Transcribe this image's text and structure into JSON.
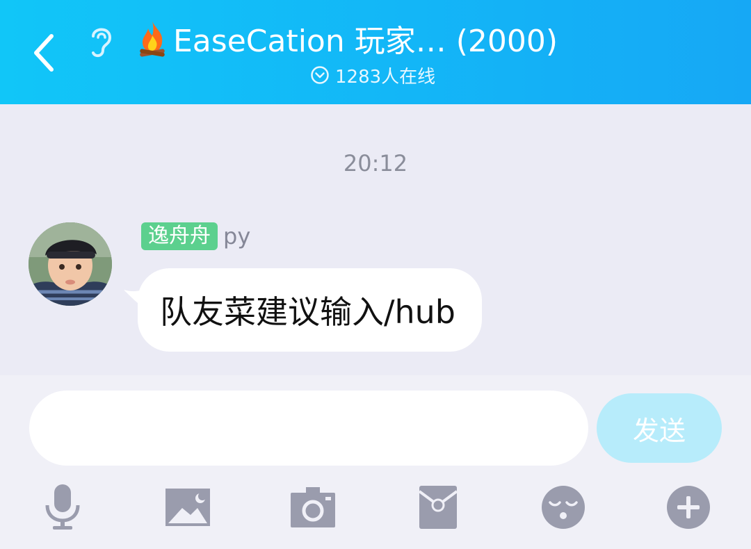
{
  "header": {
    "back_icon": "chevron-left-icon",
    "listen_icon": "ear-icon",
    "title_icon": "fire-icon",
    "title": "EaseCation 玩家… (2000)",
    "online_icon": "chevron-down-circle-icon",
    "online_text": "1283人在线",
    "gradient": [
      "#11c6f8",
      "#16a8f5"
    ]
  },
  "chat": {
    "timestamp": "20:12",
    "message": {
      "sender_tag": "逸舟舟",
      "sender_name": "py",
      "text": "队友菜建议输入/hub",
      "tag_color": "#5cd08e"
    }
  },
  "composer": {
    "input_value": "",
    "input_placeholder": "",
    "send_label": "发送",
    "send_color": "#b7ecfb"
  },
  "toolbar": {
    "items": [
      "microphone-icon",
      "image-icon",
      "camera-icon",
      "red-packet-icon",
      "emoji-icon",
      "plus-icon"
    ],
    "icon_color": "#9a9cad"
  }
}
